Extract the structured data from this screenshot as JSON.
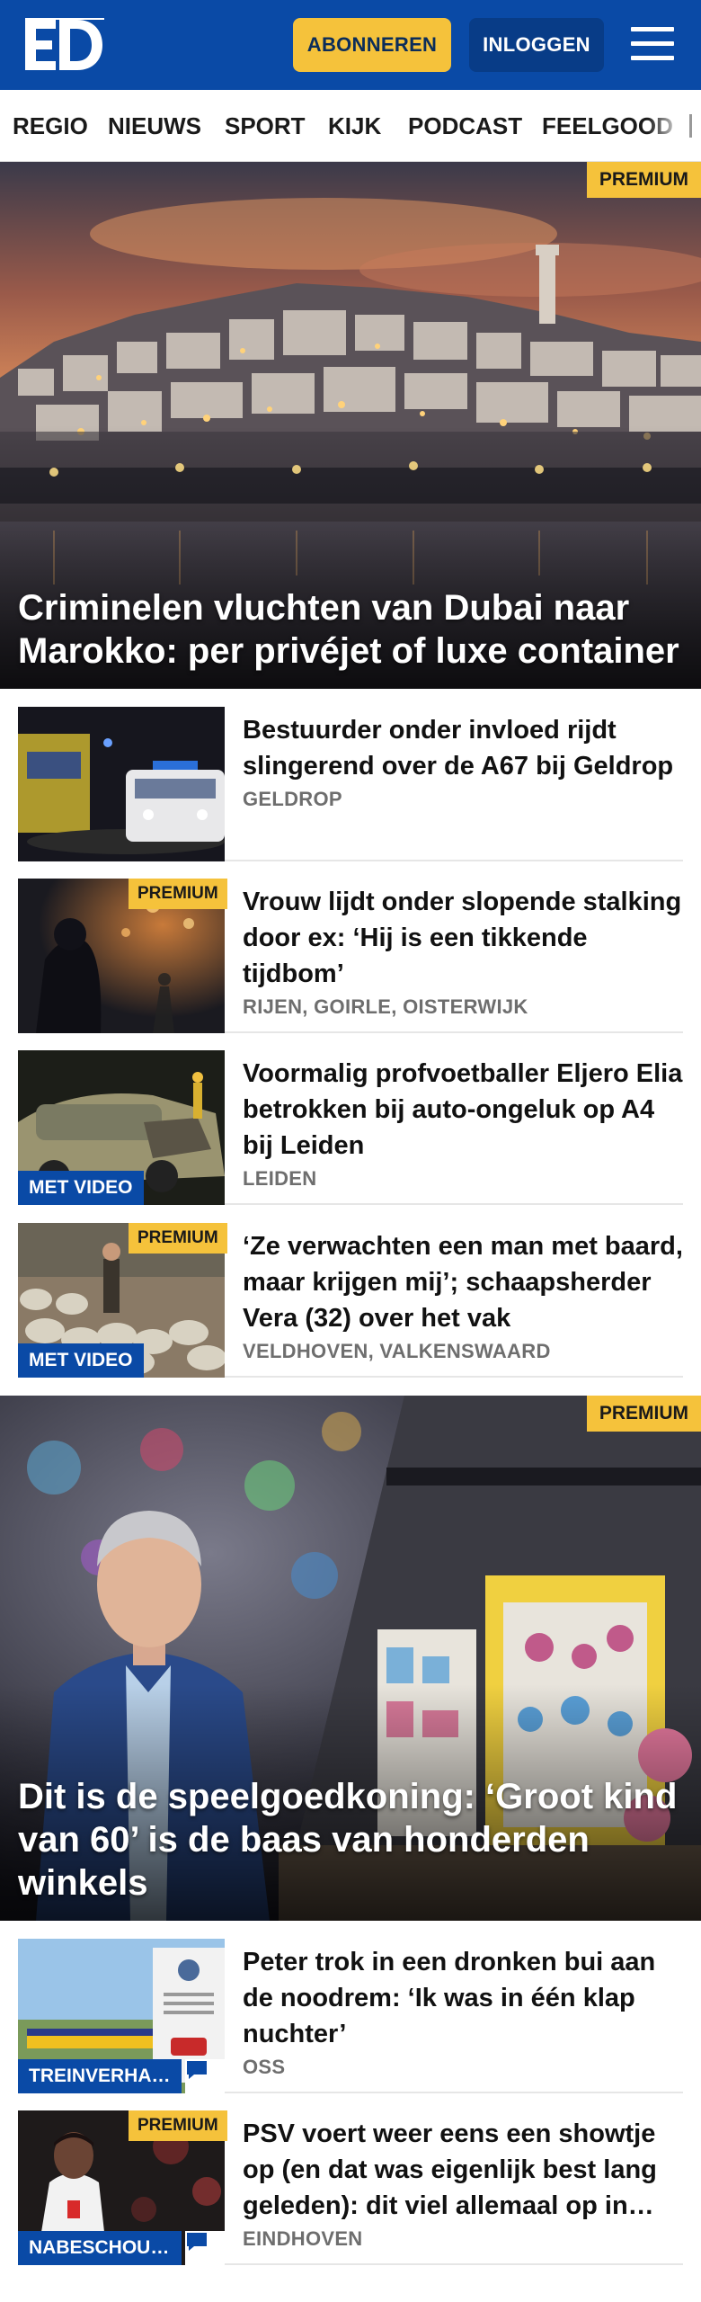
{
  "header": {
    "logo_text": "ED",
    "subscribe_label": "ABONNEREN",
    "login_label": "INLOGGEN",
    "menu_icon": "hamburger-menu-icon",
    "brand_color": "#0a4aa6",
    "accent_color": "#f5c23b"
  },
  "nav": {
    "items": [
      "REGIO",
      "NIEUWS",
      "SPORT",
      "KIJK",
      "PODCAST",
      "FEELGOOD"
    ]
  },
  "hero1": {
    "title": "Criminelen vluchten van Dubai naar Marokko: per privéjet of luxe container",
    "badge": "PREMIUM"
  },
  "articles1": [
    {
      "title": "Bestuurder onder invloed rijdt slingerend over de A67 bij Geldrop",
      "location": "GELDROP",
      "premium": "",
      "video": ""
    },
    {
      "title": "Vrouw lijdt onder slopende stalking door ex: ‘Hij is een tikkende tijdbom’",
      "location": "RIJEN, GOIRLE, OISTERWIJK",
      "premium": "PREMIUM",
      "video": ""
    },
    {
      "title": "Voormalig profvoetballer Eljero Elia betrokken bij auto-ongeluk op A4 bij Leiden",
      "location": "LEIDEN",
      "premium": "",
      "video": "MET VIDEO"
    },
    {
      "title": "‘Ze verwachten een man met baard, maar krijgen mij’; schaapsherder Vera (32) over het vak",
      "location": "VELDHOVEN, VALKENSWAARD",
      "premium": "PREMIUM",
      "video": "MET VIDEO"
    }
  ],
  "hero2": {
    "title": "Dit is de speelgoedkoning: ‘Groot kind van 60’ is de baas van honderden winkels",
    "badge": "PREMIUM"
  },
  "articles2": [
    {
      "title": "Peter trok in een dronken bui aan de noodrem: ‘Ik was in één klap nuchter’",
      "location": "OSS",
      "premium": "",
      "category": "TREINVERHALEN",
      "comment_icon": "comment-icon"
    },
    {
      "title": "PSV voert weer eens een showtje op (en dat was eigenlijk best lang geleden): dit viel allemaal op in Eindhoven",
      "location": "EINDHOVEN",
      "premium": "PREMIUM",
      "category": "NABESCHOUWING",
      "comment_icon": "comment-icon"
    }
  ]
}
